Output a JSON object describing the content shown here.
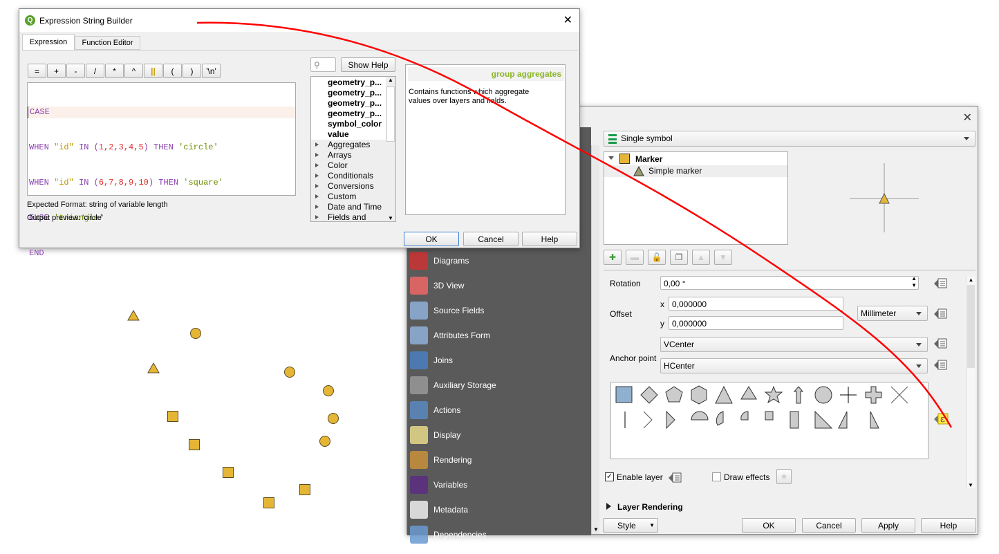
{
  "colors": {
    "accent_red": "#ff0000",
    "marker_fill": "#e5b636",
    "group_header": "#8db52a",
    "sidebar_bg": "#5a5a5a"
  },
  "map": {
    "triangles": 2,
    "circles": 5,
    "squares": 5
  },
  "layer_props": {
    "sidebar": {
      "items": [
        {
          "label": "Diagrams",
          "icon": "diagrams-icon"
        },
        {
          "label": "3D View",
          "icon": "cube-icon"
        },
        {
          "label": "Source Fields",
          "icon": "fields-icon"
        },
        {
          "label": "Attributes Form",
          "icon": "form-icon"
        },
        {
          "label": "Joins",
          "icon": "join-icon"
        },
        {
          "label": "Auxiliary Storage",
          "icon": "database-icon"
        },
        {
          "label": "Actions",
          "icon": "gear-play-icon"
        },
        {
          "label": "Display",
          "icon": "speech-bubble-icon"
        },
        {
          "label": "Rendering",
          "icon": "brush-icon"
        },
        {
          "label": "Variables",
          "icon": "epsilon-icon"
        },
        {
          "label": "Metadata",
          "icon": "document-pen-icon"
        },
        {
          "label": "Dependencies",
          "icon": "dependencies-icon"
        }
      ]
    },
    "renderer": "Single symbol",
    "symbol_tree": {
      "root": "Marker",
      "child": "Simple marker"
    },
    "rotation_label": "Rotation",
    "rotation": "0,00 °",
    "offset_label": "Offset",
    "x_label": "x",
    "x": "0,000000",
    "y_label": "y",
    "y": "0,000000",
    "unit": "Millimeter",
    "anchor_label": "Anchor point",
    "vanchor": "VCenter",
    "hanchor": "HCenter",
    "enable_layer": "Enable layer",
    "enable_layer_checked": true,
    "draw_effects": "Draw effects",
    "draw_effects_checked": false,
    "layer_rendering": "Layer Rendering",
    "buttons": {
      "style": "Style",
      "ok": "OK",
      "cancel": "Cancel",
      "apply": "Apply",
      "help": "Help"
    }
  },
  "expr": {
    "title": "Expression String Builder",
    "tabs": [
      "Expression",
      "Function Editor"
    ],
    "operators": [
      "=",
      "+",
      "-",
      "/",
      "*",
      "^",
      "||",
      "(",
      ")",
      "'\\n'"
    ],
    "code": {
      "l1": "CASE",
      "l2": [
        "WHEN",
        " \"id\" ",
        "IN",
        " (",
        "1,2,3,4,5",
        ") ",
        "THEN",
        " 'circle'"
      ],
      "l3": [
        "WHEN",
        " \"id\" ",
        "IN",
        " (",
        "6,7,8,9,10",
        ") ",
        "THEN",
        " 'square'"
      ],
      "l4": [
        "ELSE",
        " 'triangle'"
      ],
      "l5": "END"
    },
    "expected_format": "Expected Format: string of variable length",
    "output_preview": "Output preview:  'circle'",
    "show_help": "Show Help",
    "functions": [
      {
        "label": "geometry_p...",
        "bold": true
      },
      {
        "label": "geometry_p...",
        "bold": true
      },
      {
        "label": "geometry_p...",
        "bold": true
      },
      {
        "label": "geometry_p...",
        "bold": true
      },
      {
        "label": "symbol_color",
        "bold": true
      },
      {
        "label": "value",
        "bold": true
      },
      {
        "label": "Aggregates"
      },
      {
        "label": "Arrays"
      },
      {
        "label": "Color"
      },
      {
        "label": "Conditionals"
      },
      {
        "label": "Conversions"
      },
      {
        "label": "Custom"
      },
      {
        "label": "Date and Time"
      },
      {
        "label": "Fields and Val..."
      }
    ],
    "help_title": "group aggregates",
    "help_text": "Contains functions which aggregate values over layers and fields.",
    "buttons": {
      "ok": "OK",
      "cancel": "Cancel",
      "help": "Help"
    }
  }
}
